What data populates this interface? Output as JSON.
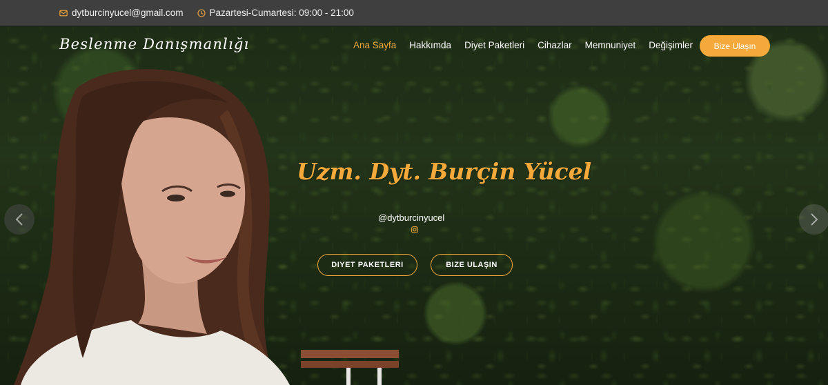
{
  "topbar": {
    "email": "dytburcinyucel@gmail.com",
    "hours": "Pazartesi-Cumartesi: 09:00 - 21:00",
    "email_icon": "mail-icon",
    "hours_icon": "clock-icon"
  },
  "nav": {
    "brand": "Beslenme Danışmanlığı",
    "items": [
      "Ana Sayfa",
      "Hakkımda",
      "Diyet Paketleri",
      "Cihazlar",
      "Memnuniyet",
      "Değişimler"
    ],
    "active_index": 0,
    "cta_label": "Bize Ulaşın"
  },
  "hero": {
    "title": "Uzm. Dyt. Burçin Yücel",
    "instagram_handle": "@dytburcinyucel",
    "instagram_icon": "instagram-icon",
    "button_packages": "DIYET PAKETLERI",
    "button_contact": "BIZE ULAŞIN"
  },
  "colors": {
    "accent": "#f5a93b",
    "topbar_bg": "#3f3f3f",
    "text_light": "#ffffff"
  }
}
